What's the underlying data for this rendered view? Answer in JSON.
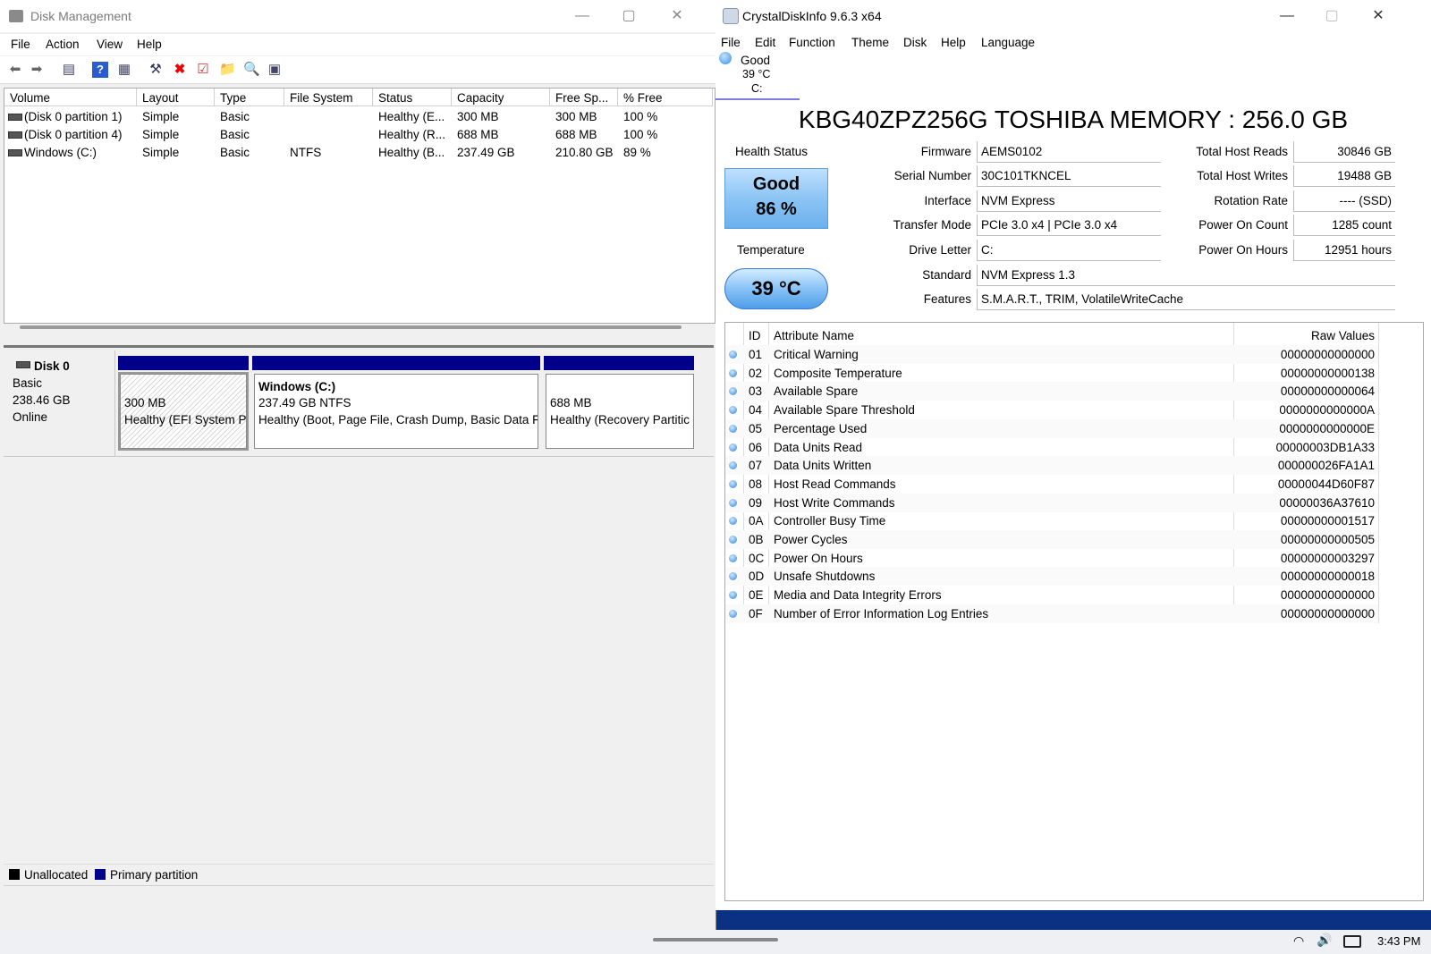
{
  "disk_management": {
    "title": "Disk Management",
    "menu": [
      "File",
      "Action",
      "View",
      "Help"
    ],
    "columns": [
      "Volume",
      "Layout",
      "Type",
      "File System",
      "Status",
      "Capacity",
      "Free Sp...",
      "% Free"
    ],
    "rows": [
      [
        "(Disk 0 partition 1)",
        "Simple",
        "Basic",
        "",
        "Healthy (E...",
        "300 MB",
        "300 MB",
        "100 %"
      ],
      [
        "(Disk 0 partition 4)",
        "Simple",
        "Basic",
        "",
        "Healthy (R...",
        "688 MB",
        "688 MB",
        "100 %"
      ],
      [
        "Windows (C:)",
        "Simple",
        "Basic",
        "NTFS",
        "Healthy (B...",
        "237.49 GB",
        "210.80 GB",
        "89 %"
      ]
    ],
    "disk": {
      "name": "Disk 0",
      "type": "Basic",
      "size": "238.46 GB",
      "state": "Online"
    },
    "partitions": [
      {
        "name": "",
        "size": "300 MB",
        "status": "Healthy (EFI System P"
      },
      {
        "name": "Windows  (C:)",
        "size": "237.49 GB NTFS",
        "status": "Healthy (Boot, Page File, Crash Dump, Basic Data F"
      },
      {
        "name": "",
        "size": "688 MB",
        "status": "Healthy (Recovery Partitic"
      }
    ],
    "legend": [
      "Unallocated",
      "Primary partition"
    ],
    "colors": {
      "primary": "#00008b",
      "unallocated": "#000000"
    }
  },
  "crystal": {
    "title": "CrystalDiskInfo 9.6.3 x64",
    "menu": [
      "File",
      "Edit",
      "Function",
      "Theme",
      "Disk",
      "Help",
      "Language"
    ],
    "tab": {
      "status": "Good",
      "temp": "39 °C",
      "drive": "C:"
    },
    "model": "KBG40ZPZ256G TOSHIBA MEMORY : 256.0 GB",
    "health_label": "Health Status",
    "health_status": "Good",
    "health_percent": "86 %",
    "temp_label": "Temperature",
    "temp_value": "39 °C",
    "fields": {
      "firmware": {
        "label": "Firmware",
        "value": "AEMS0102"
      },
      "serial": {
        "label": "Serial Number",
        "value": "30C101TKNCEL"
      },
      "interface": {
        "label": "Interface",
        "value": "NVM Express"
      },
      "transfer": {
        "label": "Transfer Mode",
        "value": "PCIe 3.0 x4 | PCIe 3.0 x4"
      },
      "drive_letter": {
        "label": "Drive Letter",
        "value": "C:"
      },
      "standard": {
        "label": "Standard",
        "value": "NVM Express 1.3"
      },
      "features": {
        "label": "Features",
        "value": "S.M.A.R.T., TRIM, VolatileWriteCache"
      }
    },
    "right_fields": {
      "reads": {
        "label": "Total Host Reads",
        "value": "30846 GB"
      },
      "writes": {
        "label": "Total Host Writes",
        "value": "19488 GB"
      },
      "rotation": {
        "label": "Rotation Rate",
        "value": "---- (SSD)"
      },
      "power_count": {
        "label": "Power On Count",
        "value": "1285 count"
      },
      "power_hours": {
        "label": "Power On Hours",
        "value": "12951 hours"
      }
    },
    "smart_headers": {
      "id": "ID",
      "name": "Attribute Name",
      "raw": "Raw Values"
    },
    "smart": [
      {
        "id": "01",
        "name": "Critical Warning",
        "raw": "00000000000000"
      },
      {
        "id": "02",
        "name": "Composite Temperature",
        "raw": "00000000000138"
      },
      {
        "id": "03",
        "name": "Available Spare",
        "raw": "00000000000064"
      },
      {
        "id": "04",
        "name": "Available Spare Threshold",
        "raw": "0000000000000A"
      },
      {
        "id": "05",
        "name": "Percentage Used",
        "raw": "0000000000000E"
      },
      {
        "id": "06",
        "name": "Data Units Read",
        "raw": "00000003DB1A33"
      },
      {
        "id": "07",
        "name": "Data Units Written",
        "raw": "000000026FA1A1"
      },
      {
        "id": "08",
        "name": "Host Read Commands",
        "raw": "00000044D60F87"
      },
      {
        "id": "09",
        "name": "Host Write Commands",
        "raw": "00000036A37610"
      },
      {
        "id": "0A",
        "name": "Controller Busy Time",
        "raw": "00000000001517"
      },
      {
        "id": "0B",
        "name": "Power Cycles",
        "raw": "00000000000505"
      },
      {
        "id": "0C",
        "name": "Power On Hours",
        "raw": "00000000003297"
      },
      {
        "id": "0D",
        "name": "Unsafe Shutdowns",
        "raw": "00000000000018"
      },
      {
        "id": "0E",
        "name": "Media and Data Integrity Errors",
        "raw": "00000000000000"
      },
      {
        "id": "0F",
        "name": "Number of Error Information Log Entries",
        "raw": "00000000000000"
      }
    ]
  },
  "taskbar": {
    "time": "3:43 PM",
    "icons": [
      "wifi-icon",
      "speaker-icon",
      "battery-icon"
    ]
  }
}
